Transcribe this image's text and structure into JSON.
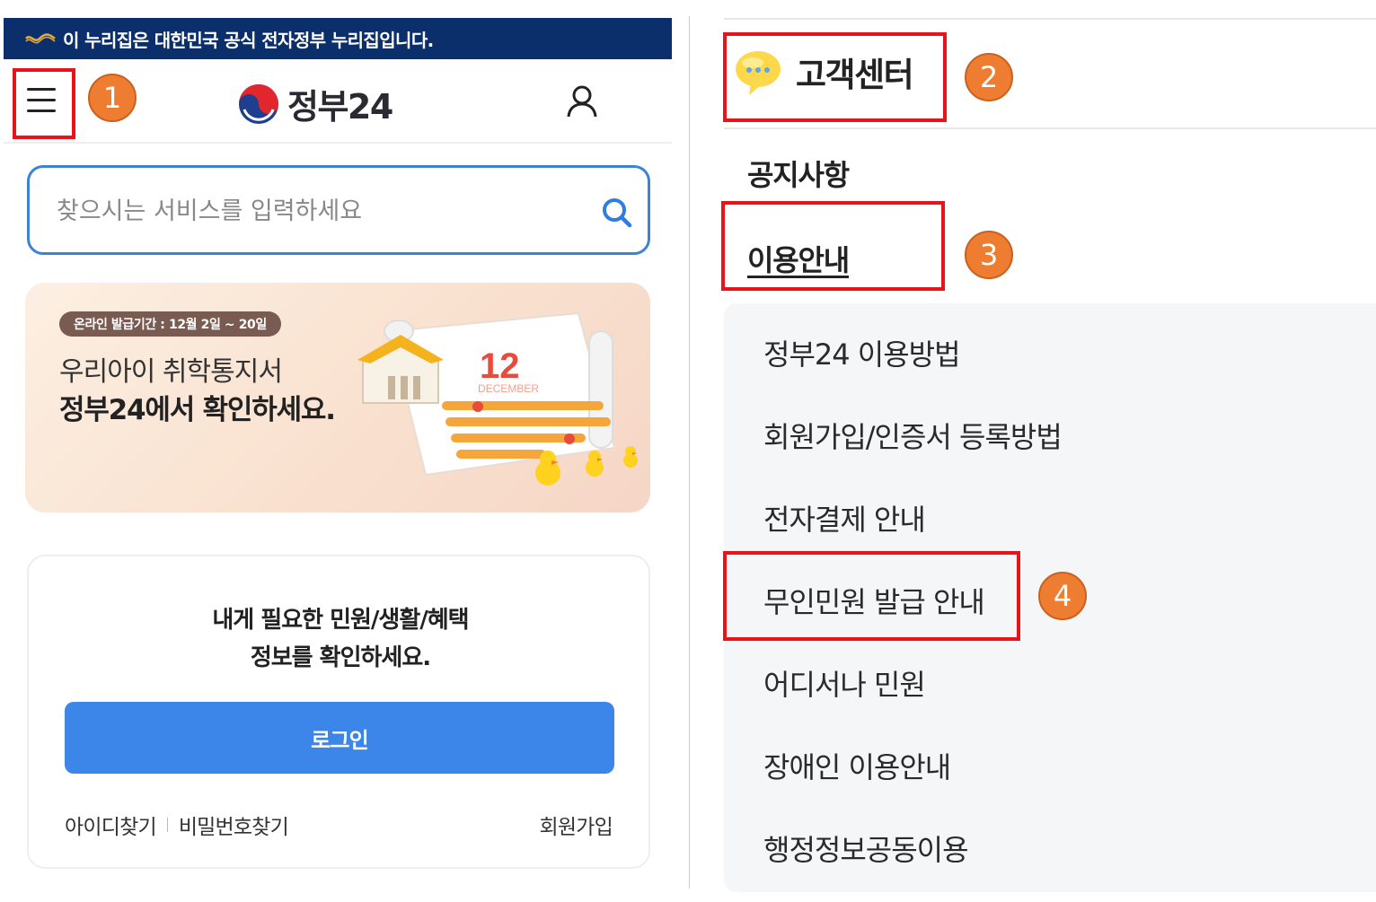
{
  "left": {
    "gov_banner": {
      "text": "이 누리집은 대한민국 공식 전자정부 누리집입니다."
    },
    "header": {
      "logo_text": "정부24",
      "menu_icon": "hamburger-menu-icon",
      "user_icon": "user-icon"
    },
    "search": {
      "placeholder": "찾으시는 서비스를 입력하세요",
      "icon": "search-icon"
    },
    "banner": {
      "pill": "온라인 발급기간 : 12월 2일 ~ 20일",
      "line1": "우리아이 취학통지서",
      "line2": "정부24에서 확인하세요.",
      "calendar_number": "12",
      "calendar_month": "DECEMBER"
    },
    "login_card": {
      "title_line1": "내게 필요한 민원/생활/혜택",
      "title_line2": "정보를 확인하세요.",
      "login_label": "로그인",
      "find_id": "아이디찾기",
      "find_pw": "비밀번호찾기",
      "signup": "회원가입"
    }
  },
  "right": {
    "customer_center": "고객센터",
    "menu": {
      "notice": "공지사항",
      "guide": "이용안내"
    },
    "submenu": [
      "정부24 이용방법",
      "회원가입/인증서 등록방법",
      "전자결제 안내",
      "무인민원 발급 안내",
      "어디서나 민원",
      "장애인 이용안내",
      "행정정보공동이용"
    ]
  },
  "annotations": {
    "step1": "1",
    "step2": "2",
    "step3": "3",
    "step4": "4",
    "box_color": "#e8141a",
    "badge_color": "#ee7d31"
  },
  "colors": {
    "gov_bar": "#0b2f6b",
    "accent_blue": "#3b86e8",
    "search_border": "#3b82d9"
  }
}
